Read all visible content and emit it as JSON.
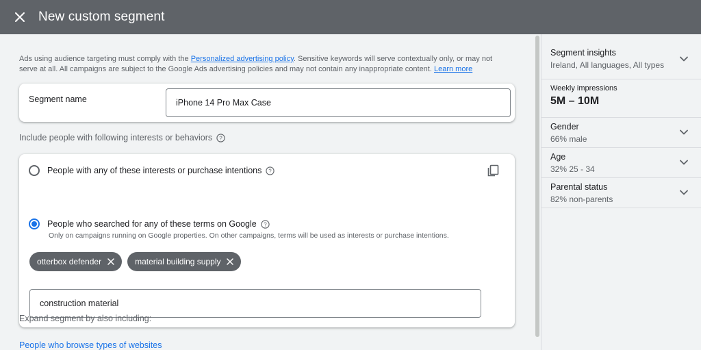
{
  "topbar": {
    "title": "New custom segment",
    "close_icon": "close-icon"
  },
  "notice": {
    "text_before": "Ads using audience targeting must comply with the ",
    "policy_link": "Personalized advertising policy",
    "text_after": ". Sensitive keywords will serve contextually only, or may not serve at all. All campaigns are subject to the Google Ads advertising policies and may not contain any inappropriate content. ",
    "learn_more": "Learn more"
  },
  "segment": {
    "label": "Segment name",
    "value": "iPhone 14 Pro Max Case"
  },
  "include": {
    "label": "Include people with following interests or behaviors",
    "options": [
      {
        "label": "People with any of these interests or purchase intentions",
        "selected": false
      },
      {
        "label": "People who searched for any of these terms on Google",
        "selected": true
      }
    ],
    "note": "Only on campaigns running on Google properties. On other campaigns, terms will be used as interests or purchase intentions.",
    "chips": [
      "otterbox defender",
      "material building supply"
    ],
    "term_input": "construction material"
  },
  "expand": {
    "label": "Expand segment by also including:",
    "link": "People who browse types of websites"
  },
  "insights": {
    "segment_title": "Segment insights",
    "segment_sub": "Ireland, All languages, All types",
    "impressions_label": "Weekly impressions",
    "impressions_value": "5M – 10M",
    "gender_title": "Gender",
    "gender_sub": "66% male",
    "age_title": "Age",
    "age_sub": "32% 25 - 34",
    "parental_title": "Parental status",
    "parental_sub": "82% non-parents"
  },
  "colors": {
    "topbar": "#5f6368",
    "accent": "#1a73e8",
    "chip": "#5f6368",
    "background": "#f1f3f4"
  }
}
